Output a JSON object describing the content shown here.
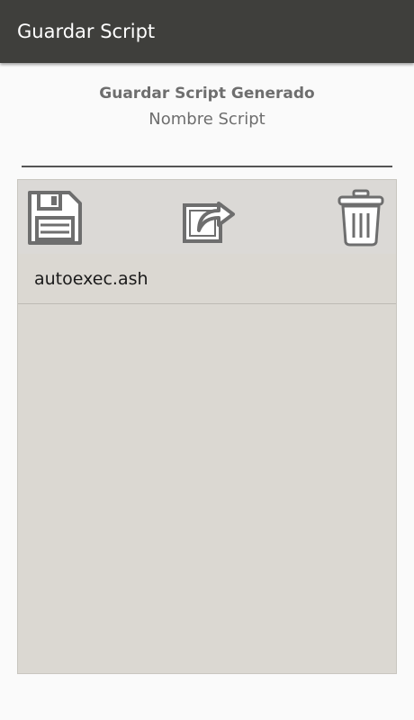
{
  "app_bar": {
    "title": "Guardar Script"
  },
  "form": {
    "heading": "Guardar Script Generado",
    "subheading": "Nombre Script",
    "name_value": "",
    "name_placeholder": ""
  },
  "toolbar": {
    "save_icon": "floppy-disk-icon",
    "export_icon": "share-export-icon",
    "delete_icon": "trash-can-icon"
  },
  "files": [
    {
      "name": "autoexec.ash"
    }
  ],
  "colors": {
    "app_bar": "#3f3f3c",
    "panel": "#dbd8d2",
    "icon": "#6e6e6e"
  }
}
